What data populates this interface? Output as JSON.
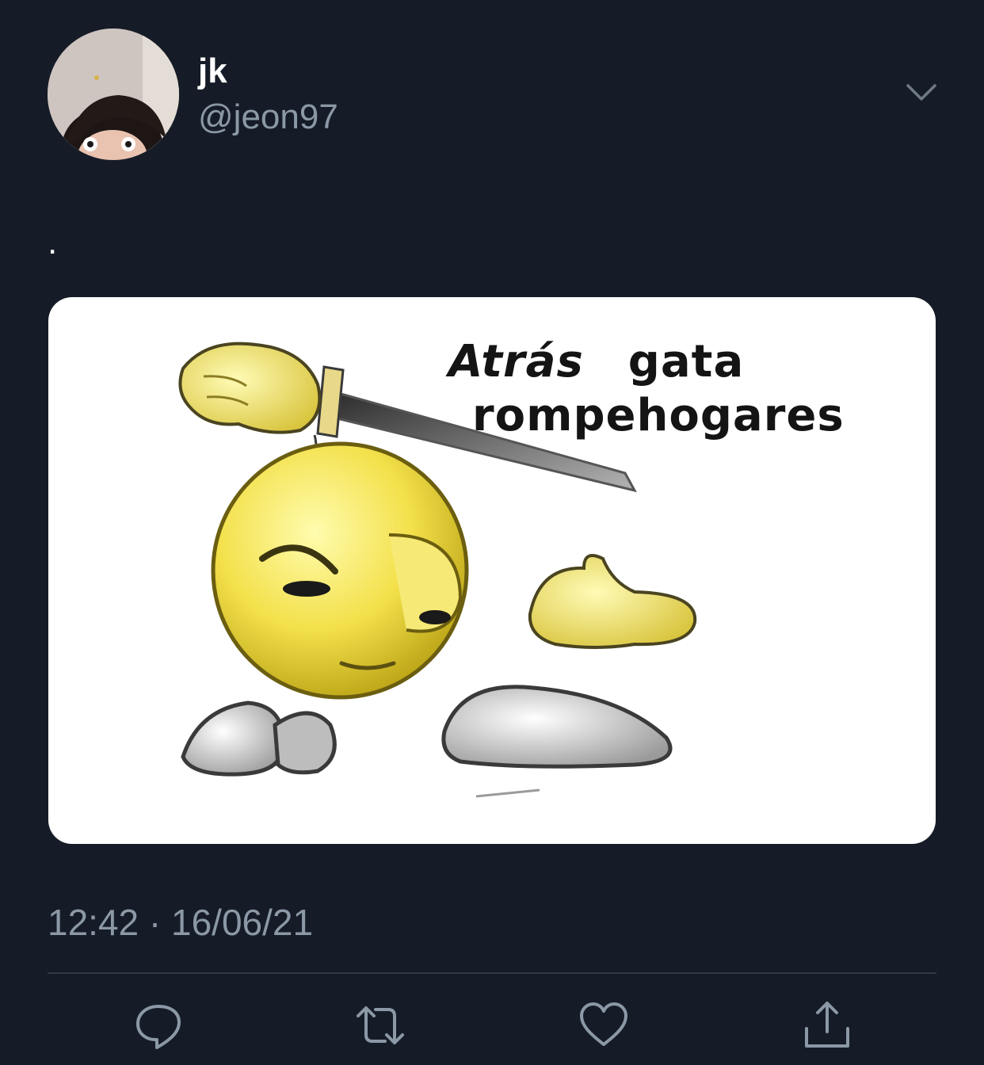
{
  "tweet": {
    "author": {
      "display_name": "jk",
      "handle": "@jeon97",
      "avatar_icon": "avatar-photo"
    },
    "text": ".",
    "media": {
      "caption_line1_word1": "Atrás",
      "caption_line1_word2": "gata",
      "caption_line2": "rompehogares"
    },
    "timestamp": "12:42 · 16/06/21",
    "actions": [
      {
        "icon": "reply-icon"
      },
      {
        "icon": "retweet-icon"
      },
      {
        "icon": "like-icon"
      },
      {
        "icon": "share-icon"
      }
    ]
  },
  "colors": {
    "background": "#161c27",
    "secondary_text": "#8b98a5",
    "divider": "#2f3946"
  }
}
